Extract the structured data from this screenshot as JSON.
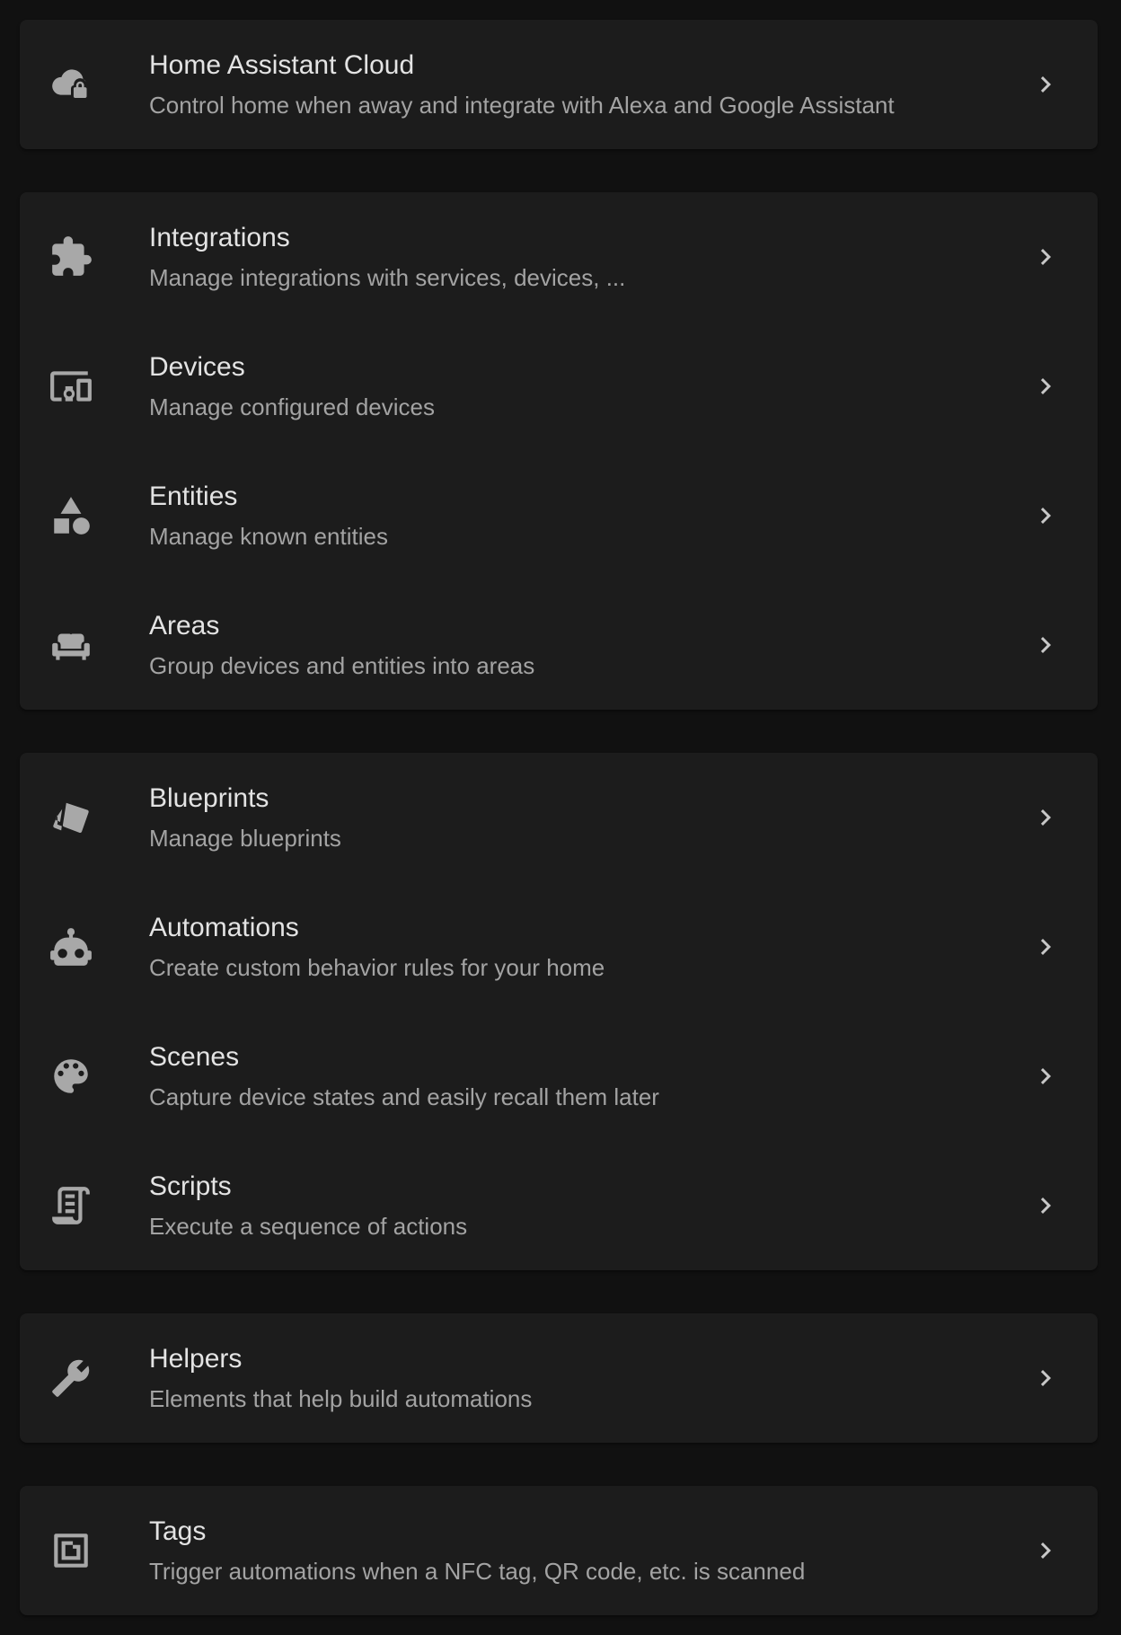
{
  "colors": {
    "background": "#111111",
    "card": "#1c1c1c",
    "title": "#e3e3e3",
    "subtitle": "#a3a3a3",
    "icon": "#a8a8a8"
  },
  "groups": [
    {
      "items": [
        {
          "icon": "cloud-lock-icon",
          "title": "Home Assistant Cloud",
          "subtitle": "Control home when away and integrate with Alexa and Google Assistant"
        }
      ]
    },
    {
      "items": [
        {
          "icon": "puzzle-icon",
          "title": "Integrations",
          "subtitle": "Manage integrations with services, devices, ..."
        },
        {
          "icon": "devices-icon",
          "title": "Devices",
          "subtitle": "Manage configured devices"
        },
        {
          "icon": "shapes-icon",
          "title": "Entities",
          "subtitle": "Manage known entities"
        },
        {
          "icon": "sofa-icon",
          "title": "Areas",
          "subtitle": "Group devices and entities into areas"
        }
      ]
    },
    {
      "items": [
        {
          "icon": "blueprint-icon",
          "title": "Blueprints",
          "subtitle": "Manage blueprints"
        },
        {
          "icon": "robot-icon",
          "title": "Automations",
          "subtitle": "Create custom behavior rules for your home"
        },
        {
          "icon": "palette-icon",
          "title": "Scenes",
          "subtitle": "Capture device states and easily recall them later"
        },
        {
          "icon": "script-icon",
          "title": "Scripts",
          "subtitle": "Execute a sequence of actions"
        }
      ]
    },
    {
      "items": [
        {
          "icon": "tools-icon",
          "title": "Helpers",
          "subtitle": "Elements that help build automations"
        }
      ]
    },
    {
      "items": [
        {
          "icon": "nfc-tag-icon",
          "title": "Tags",
          "subtitle": "Trigger automations when a NFC tag, QR code, etc. is scanned"
        }
      ]
    }
  ]
}
